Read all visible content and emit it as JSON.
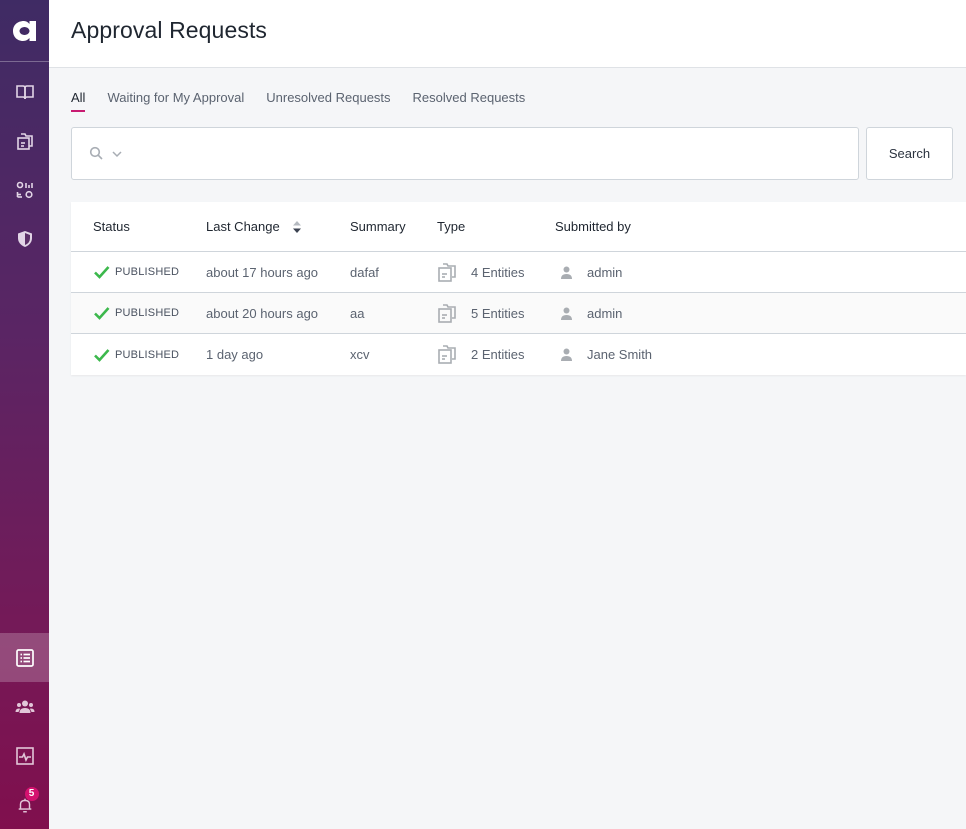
{
  "sidebar": {
    "logo_icon": "app-logo-a",
    "top_items": [
      {
        "name": "catalog",
        "icon": "book-icon"
      },
      {
        "name": "entities",
        "icon": "documents-icon"
      },
      {
        "name": "types",
        "icon": "shapes-list-icon"
      },
      {
        "name": "security",
        "icon": "shield-icon"
      }
    ],
    "bottom_items": [
      {
        "name": "approval-requests",
        "icon": "list-icon",
        "active": true
      },
      {
        "name": "users",
        "icon": "users-icon"
      },
      {
        "name": "activity",
        "icon": "pulse-monitor-icon"
      },
      {
        "name": "notifications",
        "icon": "bell-icon",
        "badge": "5"
      }
    ]
  },
  "header": {
    "title": "Approval Requests"
  },
  "tabs": [
    {
      "label": "All",
      "active": true
    },
    {
      "label": "Waiting for My Approval"
    },
    {
      "label": "Unresolved Requests"
    },
    {
      "label": "Resolved Requests"
    }
  ],
  "search": {
    "value": "",
    "placeholder": "",
    "button_label": "Search"
  },
  "table": {
    "columns": [
      "Status",
      "Last Change",
      "Summary",
      "Type",
      "Submitted by"
    ],
    "rows": [
      {
        "status": "PUBLISHED",
        "last_change": "about 17 hours ago",
        "summary": "dafaf",
        "type": "4 Entities",
        "submitted_by": "admin"
      },
      {
        "status": "PUBLISHED",
        "last_change": "about 20 hours ago",
        "summary": "aa",
        "type": "5 Entities",
        "submitted_by": "admin"
      },
      {
        "status": "PUBLISHED",
        "last_change": "1 day ago",
        "summary": "xcv",
        "type": "2 Entities",
        "submitted_by": "Jane Smith"
      }
    ]
  },
  "colors": {
    "accent": "#c81b71",
    "success": "#3cb84c",
    "badge": "#d4126f"
  }
}
